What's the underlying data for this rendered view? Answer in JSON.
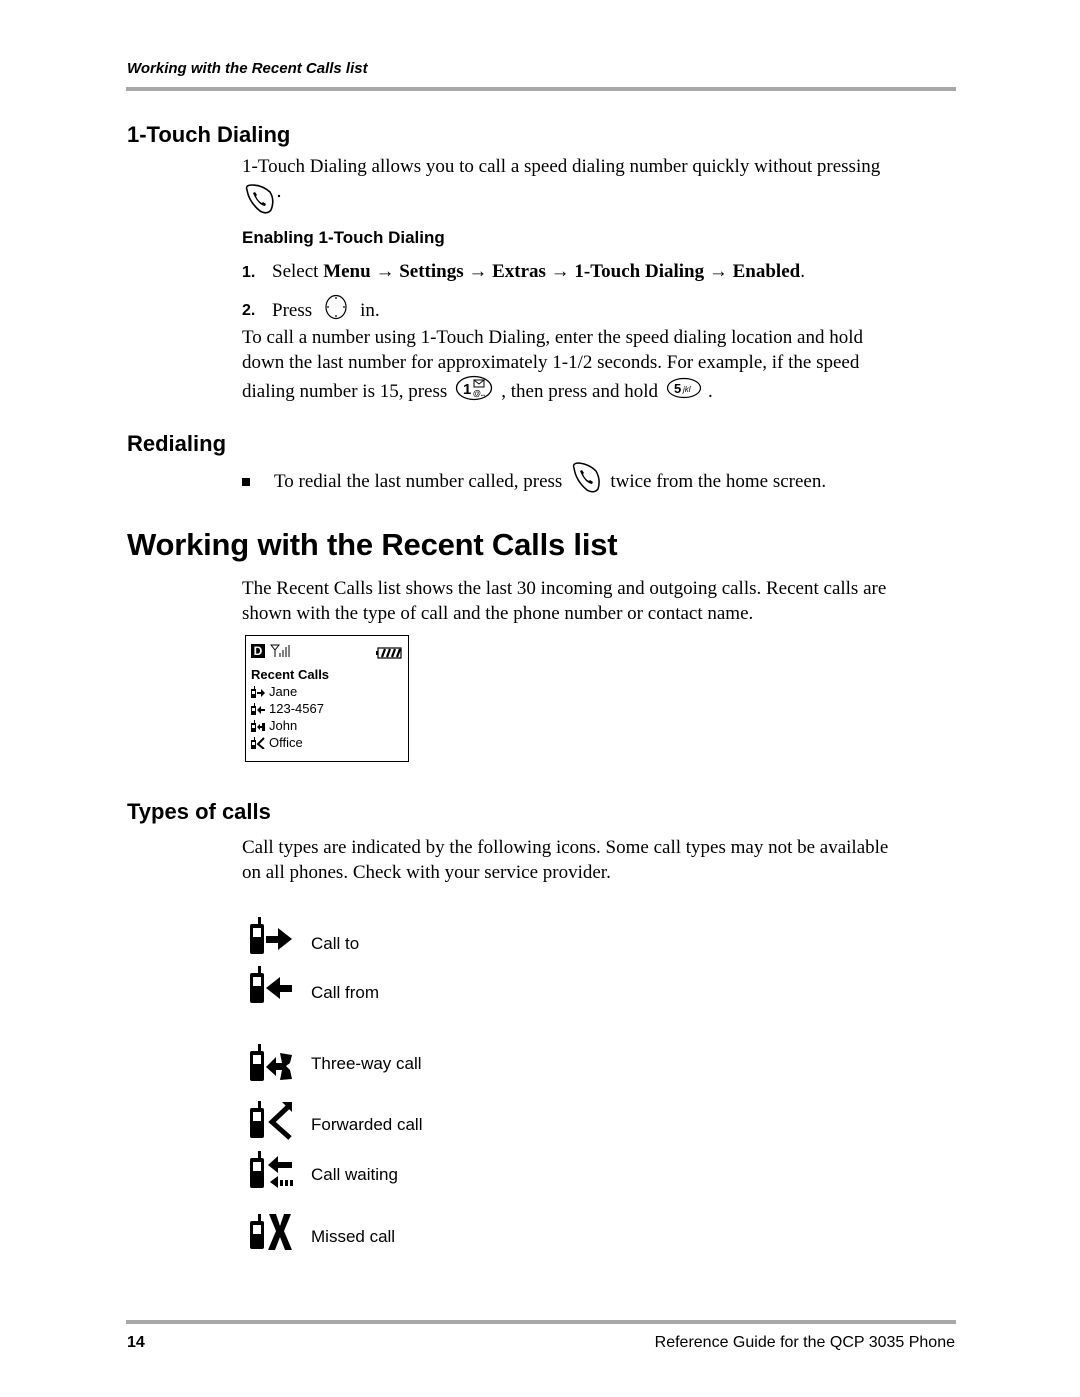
{
  "running_header": "Working with the Recent Calls list",
  "one_touch": {
    "heading": "1-Touch Dialing",
    "intro": "1-Touch Dialing allows you to call a speed dialing number quickly without pressing",
    "intro_end": ".",
    "sub_heading": "Enabling 1-Touch Dialing",
    "step1": {
      "num": "1.",
      "prefix": "Select ",
      "path": [
        "Menu",
        "Settings",
        "Extras",
        "1-Touch Dialing",
        "Enabled"
      ],
      "arrow": "→",
      "end": "."
    },
    "step2": {
      "num": "2.",
      "prefix": "Press",
      "suffix": "in."
    },
    "para_line1": "To call a number using 1-Touch Dialing, enter the speed dialing location and hold",
    "para_line2": "down the last number for approximately 1-1/2 seconds. For example, if the speed",
    "para_line3_a": "dialing number is 15, press",
    "para_line3_b": ", then press and hold",
    "para_line3_c": ".",
    "key1_label": "1",
    "key5_label": "5",
    "key5_sub": "jkl"
  },
  "redialing": {
    "heading": "Redialing",
    "bullet_a": "To redial the last number called, press",
    "bullet_b": "twice from the home screen."
  },
  "recent_calls": {
    "heading": "Working with the Recent Calls list",
    "para_line1": "The Recent Calls list shows the last 30 incoming and outgoing calls.  Recent calls are",
    "para_line2": "shown with the type of call and the phone number or contact name.",
    "screen": {
      "indicator": "D",
      "title": "Recent Calls",
      "items": [
        {
          "icon": "call-to-icon",
          "label": "Jane"
        },
        {
          "icon": "call-from-icon",
          "label": "123-4567"
        },
        {
          "icon": "three-way-call-icon",
          "label": "John"
        },
        {
          "icon": "forwarded-call-icon",
          "label": "Office"
        }
      ]
    }
  },
  "types_of_calls": {
    "heading": "Types of calls",
    "para_line1": "Call types are indicated by the following icons. Some call types may not be available",
    "para_line2": "on all phones. Check with your service provider.",
    "types": [
      {
        "icon": "call-to-icon",
        "label": "Call to"
      },
      {
        "icon": "call-from-icon",
        "label": "Call from"
      },
      {
        "icon": "three-way-call-icon",
        "label": "Three-way call"
      },
      {
        "icon": "forwarded-call-icon",
        "label": "Forwarded call"
      },
      {
        "icon": "call-waiting-icon",
        "label": "Call waiting"
      },
      {
        "icon": "missed-call-icon",
        "label": "Missed call"
      }
    ]
  },
  "footer": {
    "page_number": "14",
    "title": "Reference Guide for the QCP 3035 Phone"
  }
}
